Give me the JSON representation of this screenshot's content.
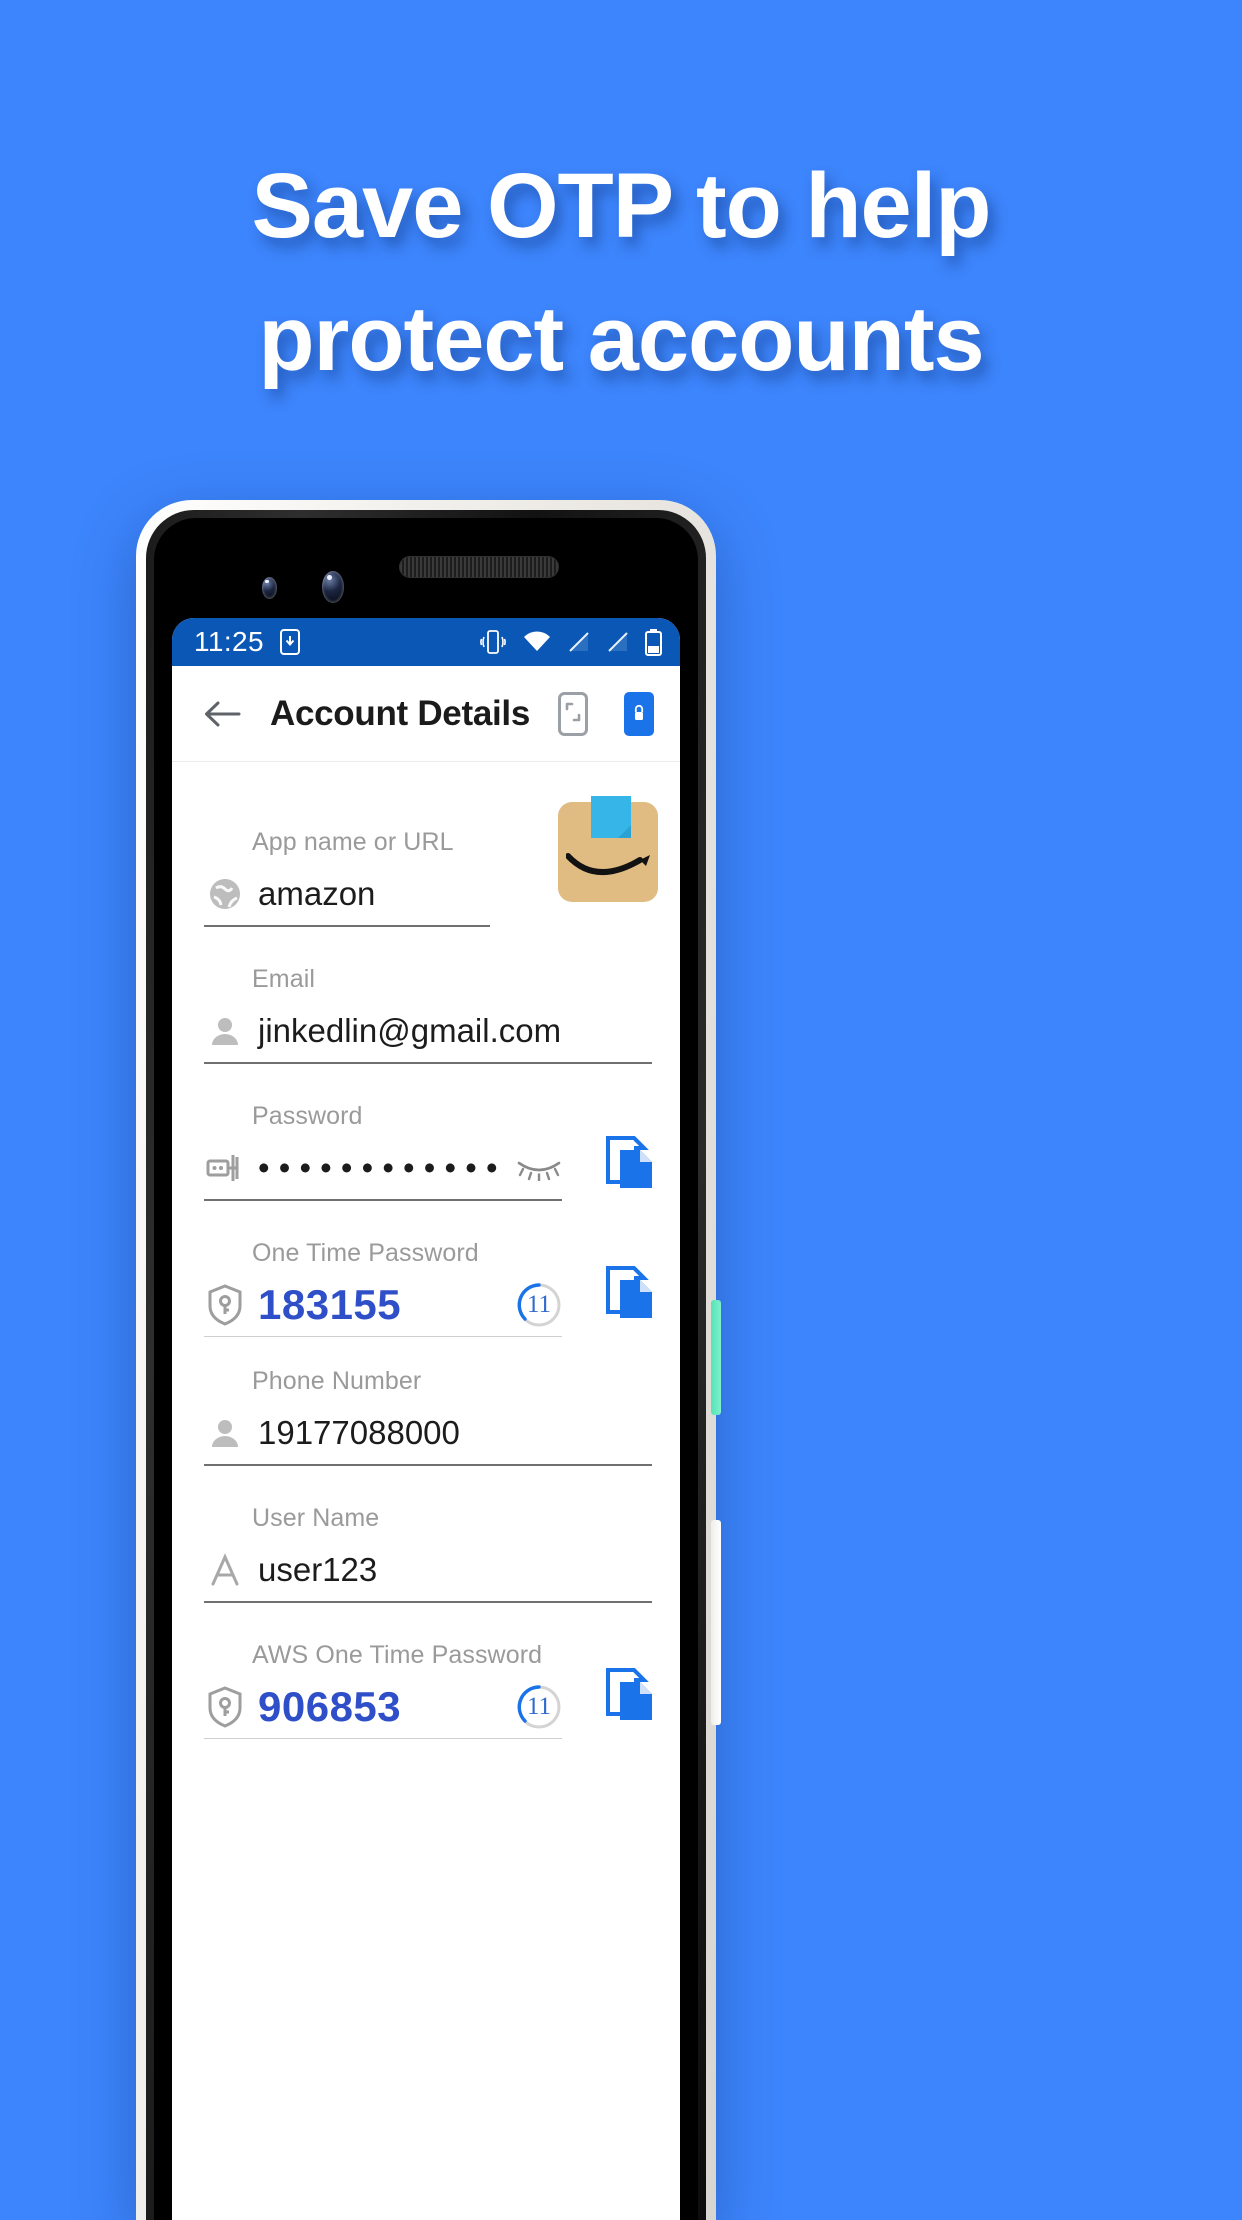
{
  "promo": {
    "line1": "Save OTP to help",
    "line2": "protect accounts",
    "background_color": "#3d85fc",
    "text_color": "#ffffff"
  },
  "phone": {
    "status_bar": {
      "time": "11:25",
      "background_color": "#0b57b5",
      "icons": [
        "sim-download-icon",
        "vibrate-icon",
        "wifi-icon",
        "signal-off-icon",
        "signal-off-icon",
        "battery-icon"
      ]
    },
    "app_bar": {
      "back_label": "back-arrow",
      "title": "Account Details",
      "actions": [
        "phone-scan-icon",
        "phone-lock-icon"
      ],
      "accent_color": "#1a73e8"
    }
  },
  "form": {
    "accent_color": "#2f4fc9",
    "fields": [
      {
        "label": "App name or URL",
        "value": "amazon",
        "icon": "globe-icon",
        "type": "text",
        "has_copy": false,
        "has_logo": true
      },
      {
        "label": "Email",
        "value": "jinkedlin@gmail.com",
        "icon": "person-icon",
        "type": "text",
        "has_copy": false
      },
      {
        "label": "Password",
        "value": "• • • • • • • • • • • •",
        "icon": "key-icon",
        "type": "password",
        "has_copy": true,
        "reveal_icon": "eye-off-icon"
      },
      {
        "label": "One Time Password",
        "value": "183155",
        "icon": "shield-key-icon",
        "type": "otp",
        "countdown": "11",
        "has_copy": true
      },
      {
        "label": "Phone Number",
        "value": "19177088000",
        "icon": "person-icon",
        "type": "text",
        "has_copy": false
      },
      {
        "label": "User Name",
        "value": "user123",
        "icon": "letter-a-icon",
        "type": "text",
        "has_copy": false
      },
      {
        "label": "AWS One Time Password",
        "value": "906853",
        "icon": "shield-key-icon",
        "type": "otp",
        "countdown": "11",
        "has_copy": true
      }
    ]
  }
}
